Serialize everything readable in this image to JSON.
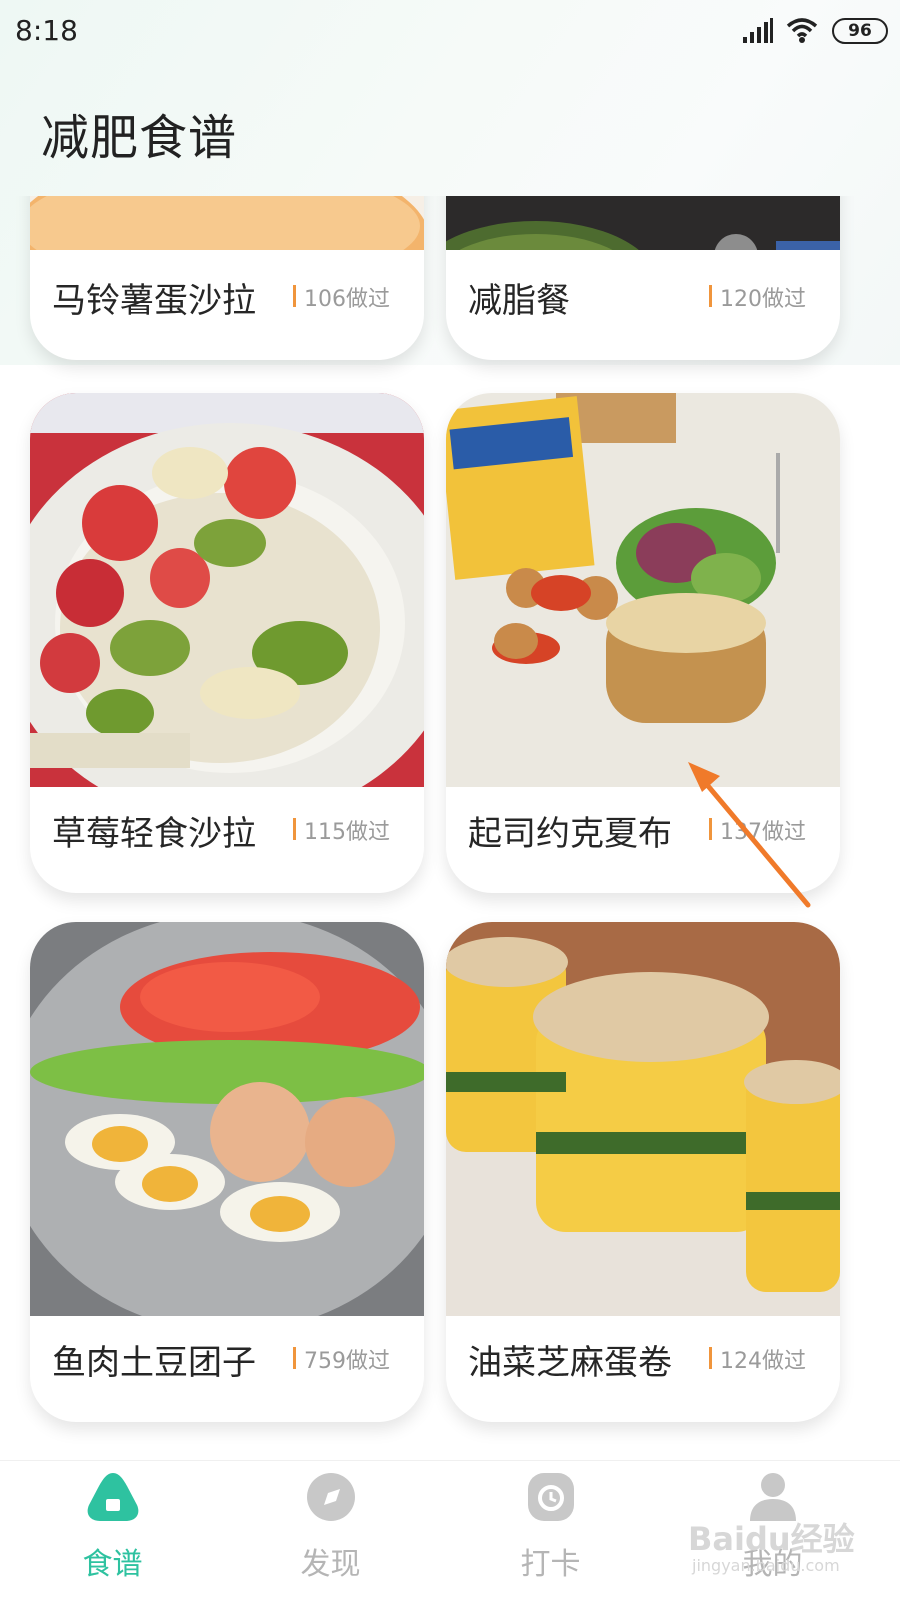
{
  "status": {
    "time": "8:18",
    "battery": "96"
  },
  "page": {
    "title": "减肥食谱"
  },
  "recipes": [
    {
      "name": "马铃薯蛋沙拉",
      "count": "106做过"
    },
    {
      "name": "减脂餐",
      "count": "120做过"
    },
    {
      "name": "草莓轻食沙拉",
      "count": "115做过"
    },
    {
      "name": "起司约克夏布",
      "count": "137做过"
    },
    {
      "name": "鱼肉土豆团子",
      "count": "759做过"
    },
    {
      "name": "油菜芝麻蛋卷",
      "count": "124做过"
    }
  ],
  "tabs": [
    {
      "label": "食谱",
      "icon": "recipe-icon",
      "active": true
    },
    {
      "label": "发现",
      "icon": "discover-icon",
      "active": false
    },
    {
      "label": "打卡",
      "icon": "clock-icon",
      "active": false
    },
    {
      "label": "我的",
      "icon": "user-icon",
      "active": false
    }
  ],
  "watermark": {
    "logo": "Baidu经验",
    "url": "jingyan.baidu.com"
  },
  "colors": {
    "accent": "#2ec2a0",
    "count_bar": "#f0953c",
    "annotation_arrow": "#f07a2a"
  }
}
